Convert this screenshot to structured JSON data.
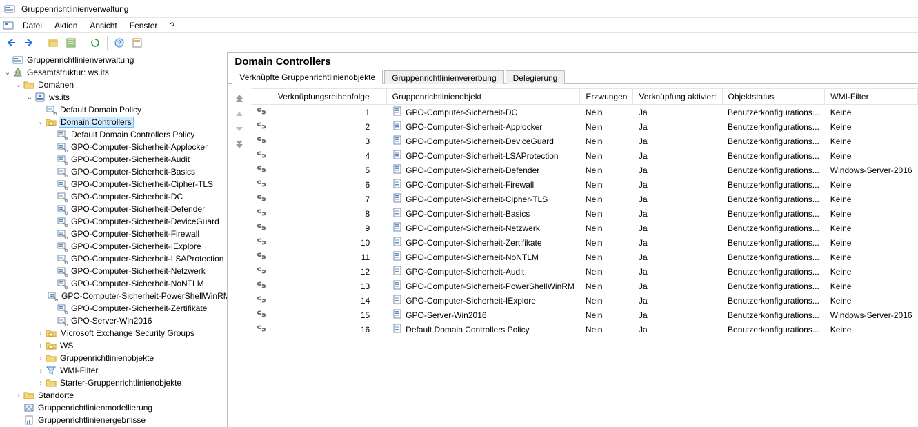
{
  "window": {
    "title": "Gruppenrichtlinienverwaltung"
  },
  "menu": {
    "items": [
      "Datei",
      "Aktion",
      "Ansicht",
      "Fenster",
      "?"
    ]
  },
  "toolbar": {
    "back": "←",
    "fwd": "→",
    "up": "↑"
  },
  "tree": {
    "root": "Gruppenrichtlinienverwaltung",
    "forest": "Gesamtstruktur: ws.its",
    "domains": "Domänen",
    "domain": "ws.its",
    "nodes": {
      "default_domain_policy": "Default Domain Policy",
      "domain_controllers": "Domain Controllers",
      "ms_exch": "Microsoft Exchange Security Groups",
      "ws": "WS",
      "gpobjects": "Gruppenrichtlinienobjekte",
      "wmi": "WMI-Filter",
      "starter": "Starter-Gruppenrichtlinienobjekte",
      "sites": "Standorte",
      "modelling": "Gruppenrichtlinienmodellierung",
      "results": "Gruppenrichtlinienergebnisse"
    },
    "dc_children": [
      "Default Domain Controllers Policy",
      "GPO-Computer-Sicherheit-Applocker",
      "GPO-Computer-Sicherheit-Audit",
      "GPO-Computer-Sicherheit-Basics",
      "GPO-Computer-Sicherheit-Cipher-TLS",
      "GPO-Computer-Sicherheit-DC",
      "GPO-Computer-Sicherheit-Defender",
      "GPO-Computer-Sicherheit-DeviceGuard",
      "GPO-Computer-Sicherheit-Firewall",
      "GPO-Computer-Sicherheit-IExplore",
      "GPO-Computer-Sicherheit-LSAProtection",
      "GPO-Computer-Sicherheit-Netzwerk",
      "GPO-Computer-Sicherheit-NoNTLM",
      "GPO-Computer-Sicherheit-PowerShellWinRM",
      "GPO-Computer-Sicherheit-Zertifikate",
      "GPO-Server-Win2016"
    ]
  },
  "content": {
    "title": "Domain Controllers",
    "tabs": [
      "Verknüpfte Gruppenrichtlinienobjekte",
      "Gruppenrichtlinienvererbung",
      "Delegierung"
    ],
    "columns": {
      "order": "Verknüpfungsreihenfolge",
      "gpo": "Gruppenrichtlinienobjekt",
      "enforced": "Erzwungen",
      "linkEnabled": "Verknüpfung aktiviert",
      "status": "Objektstatus",
      "wmi": "WMI-Filter"
    },
    "rows": [
      {
        "order": 1,
        "gpo": "GPO-Computer-Sicherheit-DC",
        "enforced": "Nein",
        "linkEnabled": "Ja",
        "status": "Benutzerkonfigurations...",
        "wmi": "Keine"
      },
      {
        "order": 2,
        "gpo": "GPO-Computer-Sicherheit-Applocker",
        "enforced": "Nein",
        "linkEnabled": "Ja",
        "status": "Benutzerkonfigurations...",
        "wmi": "Keine"
      },
      {
        "order": 3,
        "gpo": "GPO-Computer-Sicherheit-DeviceGuard",
        "enforced": "Nein",
        "linkEnabled": "Ja",
        "status": "Benutzerkonfigurations...",
        "wmi": "Keine"
      },
      {
        "order": 4,
        "gpo": "GPO-Computer-Sicherheit-LSAProtection",
        "enforced": "Nein",
        "linkEnabled": "Ja",
        "status": "Benutzerkonfigurations...",
        "wmi": "Keine"
      },
      {
        "order": 5,
        "gpo": "GPO-Computer-Sicherheit-Defender",
        "enforced": "Nein",
        "linkEnabled": "Ja",
        "status": "Benutzerkonfigurations...",
        "wmi": "Windows-Server-2016"
      },
      {
        "order": 6,
        "gpo": "GPO-Computer-Sicherheit-Firewall",
        "enforced": "Nein",
        "linkEnabled": "Ja",
        "status": "Benutzerkonfigurations...",
        "wmi": "Keine"
      },
      {
        "order": 7,
        "gpo": "GPO-Computer-Sicherheit-Cipher-TLS",
        "enforced": "Nein",
        "linkEnabled": "Ja",
        "status": "Benutzerkonfigurations...",
        "wmi": "Keine"
      },
      {
        "order": 8,
        "gpo": "GPO-Computer-Sicherheit-Basics",
        "enforced": "Nein",
        "linkEnabled": "Ja",
        "status": "Benutzerkonfigurations...",
        "wmi": "Keine"
      },
      {
        "order": 9,
        "gpo": "GPO-Computer-Sicherheit-Netzwerk",
        "enforced": "Nein",
        "linkEnabled": "Ja",
        "status": "Benutzerkonfigurations...",
        "wmi": "Keine"
      },
      {
        "order": 10,
        "gpo": "GPO-Computer-Sicherheit-Zertifikate",
        "enforced": "Nein",
        "linkEnabled": "Ja",
        "status": "Benutzerkonfigurations...",
        "wmi": "Keine"
      },
      {
        "order": 11,
        "gpo": "GPO-Computer-Sicherheit-NoNTLM",
        "enforced": "Nein",
        "linkEnabled": "Ja",
        "status": "Benutzerkonfigurations...",
        "wmi": "Keine"
      },
      {
        "order": 12,
        "gpo": "GPO-Computer-Sicherheit-Audit",
        "enforced": "Nein",
        "linkEnabled": "Ja",
        "status": "Benutzerkonfigurations...",
        "wmi": "Keine"
      },
      {
        "order": 13,
        "gpo": "GPO-Computer-Sicherheit-PowerShellWinRM",
        "enforced": "Nein",
        "linkEnabled": "Ja",
        "status": "Benutzerkonfigurations...",
        "wmi": "Keine"
      },
      {
        "order": 14,
        "gpo": "GPO-Computer-Sicherheit-IExplore",
        "enforced": "Nein",
        "linkEnabled": "Ja",
        "status": "Benutzerkonfigurations...",
        "wmi": "Keine"
      },
      {
        "order": 15,
        "gpo": "GPO-Server-Win2016",
        "enforced": "Nein",
        "linkEnabled": "Ja",
        "status": "Benutzerkonfigurations...",
        "wmi": "Windows-Server-2016"
      },
      {
        "order": 16,
        "gpo": "Default Domain Controllers Policy",
        "enforced": "Nein",
        "linkEnabled": "Ja",
        "status": "Benutzerkonfigurations...",
        "wmi": "Keine"
      }
    ]
  }
}
